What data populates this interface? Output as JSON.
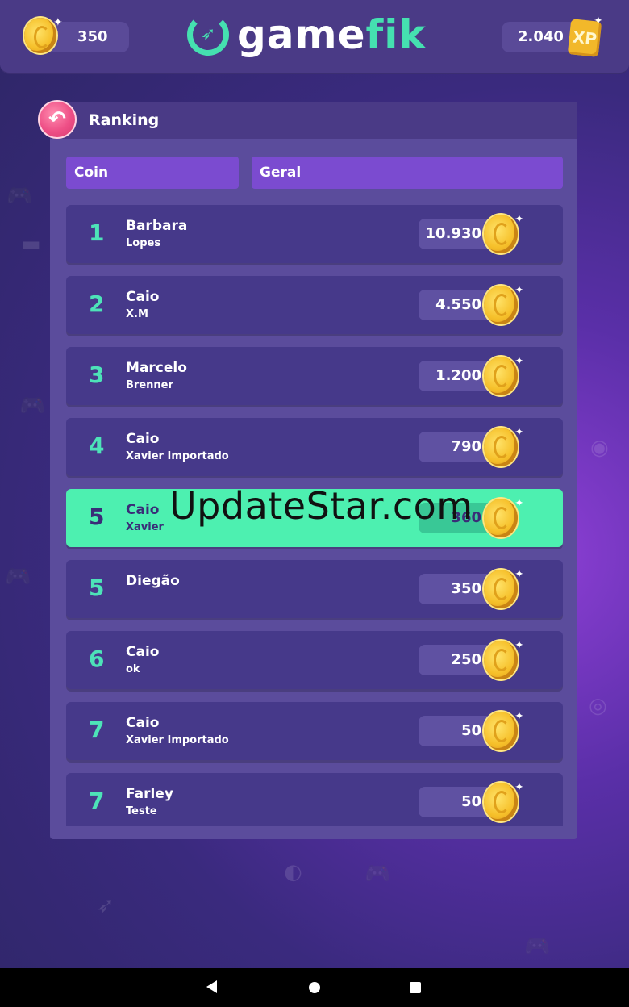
{
  "header": {
    "coins": "350",
    "logo_left": "game",
    "logo_right": "fik",
    "xp": "2.040",
    "xp_label": "XP"
  },
  "panel": {
    "title": "Ranking",
    "back_icon": "back-arrow-icon",
    "tabs": [
      {
        "label": "Coin"
      },
      {
        "label": "Geral"
      }
    ]
  },
  "ranking": [
    {
      "rank": "1",
      "name": "Barbara",
      "sub": "Lopes",
      "score": "10.930"
    },
    {
      "rank": "2",
      "name": "Caio",
      "sub": "X.M",
      "score": "4.550"
    },
    {
      "rank": "3",
      "name": "Marcelo",
      "sub": "Brenner",
      "score": "1.200"
    },
    {
      "rank": "4",
      "name": "Caio",
      "sub": "Xavier Importado",
      "score": "790"
    },
    {
      "rank": "5",
      "name": "Caio",
      "sub": "Xavier",
      "score": "360",
      "highlight": true
    },
    {
      "rank": "5",
      "name": "Diegão",
      "sub": "",
      "score": "350"
    },
    {
      "rank": "6",
      "name": "Caio",
      "sub": "ok",
      "score": "250"
    },
    {
      "rank": "7",
      "name": "Caio",
      "sub": "Xavier Importado",
      "score": "50"
    },
    {
      "rank": "7",
      "name": "Farley",
      "sub": "Teste",
      "score": "50"
    }
  ],
  "watermark": "UpdateStar.com",
  "colors": {
    "accent": "#4df0b0",
    "tab": "#7b4bd0",
    "panel": "#5b4c9c",
    "row": "#46398a",
    "coin": "#f6c02a"
  }
}
